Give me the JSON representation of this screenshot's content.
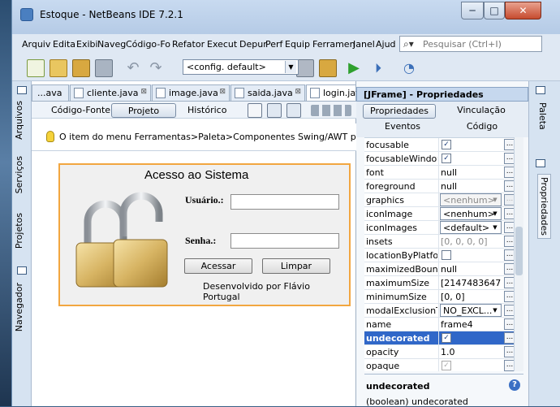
{
  "window": {
    "title": "Estoque - NetBeans IDE 7.2.1",
    "minimize": "─",
    "maximize": "□",
    "close": "✕"
  },
  "menu": [
    "Arquiv",
    "Edita",
    "Exibi",
    "Naveg",
    "Código-Fo",
    "Refator",
    "Execut",
    "Depur",
    "Perf",
    "Equip",
    "Ferramen",
    "Janel",
    "Ajud"
  ],
  "search": {
    "placeholder": "Pesquisar (Ctrl+I)",
    "icon": "search-icon"
  },
  "toolbar": {
    "config_value": "<config. default>"
  },
  "left_tabs": [
    "Arquivos",
    "Serviços",
    "Projetos",
    "Navegador"
  ],
  "file_tabs": [
    {
      "label": "...ava",
      "close": "⊠"
    },
    {
      "label": "cliente.java",
      "close": "⊠"
    },
    {
      "label": "image.java",
      "close": "⊠"
    },
    {
      "label": "saida.java",
      "close": "⊠"
    },
    {
      "label": "login.java",
      "close": "⊠"
    }
  ],
  "editor_modes": {
    "source": "Código-Fonte",
    "design": "Projeto",
    "history": "Histórico"
  },
  "hint": "O item do menu Ferramentas>Paleta>Componentes Swing/AWT permite modif",
  "form": {
    "title": "Acesso ao Sistema",
    "user_label": "Usuário.:",
    "password_label": "Senha.:",
    "login_button": "Acessar",
    "clear_button": "Limpar",
    "developer": "Desenvolvido por Flávio Portugal"
  },
  "props": {
    "title": "[JFrame] - Propriedades",
    "tabs": {
      "properties": "Propriedades",
      "binding": "Vinculação",
      "events": "Eventos",
      "code": "Código"
    },
    "rows": [
      {
        "name": "focusable",
        "kind": "check",
        "value": "✓"
      },
      {
        "name": "focusableWindowS",
        "kind": "check",
        "value": "✓"
      },
      {
        "name": "font",
        "kind": "text",
        "value": "null"
      },
      {
        "name": "foreground",
        "kind": "text",
        "value": "null"
      },
      {
        "name": "graphics",
        "kind": "gray",
        "value": "<nenhum>"
      },
      {
        "name": "iconImage",
        "kind": "combo",
        "value": "<nenhum>"
      },
      {
        "name": "iconImages",
        "kind": "combo",
        "value": "<default>"
      },
      {
        "name": "insets",
        "kind": "gray",
        "value": "[0, 0, 0, 0]"
      },
      {
        "name": "locationByPlatform",
        "kind": "check",
        "value": ""
      },
      {
        "name": "maximizedBounds",
        "kind": "text",
        "value": "null"
      },
      {
        "name": "maximumSize",
        "kind": "text",
        "value": "[2147483647..."
      },
      {
        "name": "minimumSize",
        "kind": "text",
        "value": "[0, 0]"
      },
      {
        "name": "modalExclusionType",
        "kind": "combo",
        "value": "NO_EXCL..."
      },
      {
        "name": "name",
        "kind": "text",
        "value": "frame4"
      },
      {
        "name": "undecorated",
        "kind": "check",
        "value": "✓",
        "selected": true
      },
      {
        "name": "opacity",
        "kind": "text",
        "value": "1.0"
      },
      {
        "name": "opaque",
        "kind": "gray",
        "value": "✓"
      }
    ],
    "description_title": "undecorated",
    "description_text": "(boolean) undecorated",
    "help": "?",
    "more": "..."
  },
  "right_tabs": [
    "Paleta",
    "Propriedades"
  ]
}
